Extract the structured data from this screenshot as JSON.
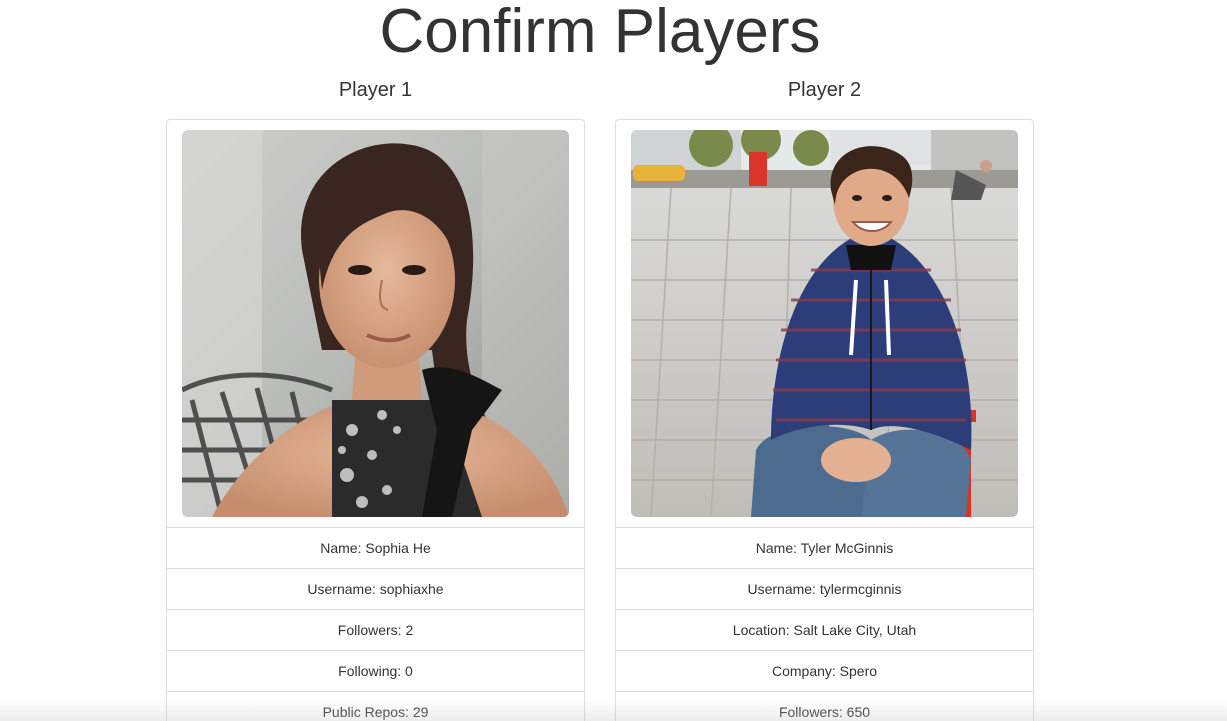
{
  "page": {
    "title": "Confirm Players"
  },
  "players": [
    {
      "heading": "Player 1",
      "fields": [
        "Name: Sophia He",
        "Username: sophiaxhe",
        "Followers: 2",
        "Following: 0",
        "Public Repos: 29"
      ]
    },
    {
      "heading": "Player 2",
      "fields": [
        "Name: Tyler McGinnis",
        "Username: tylermcginnis",
        "Location: Salt Lake City, Utah",
        "Company: Spero",
        "Followers: 650"
      ]
    }
  ],
  "colors": {
    "text": "#333333",
    "border": "#dddddd",
    "background": "#ffffff"
  }
}
